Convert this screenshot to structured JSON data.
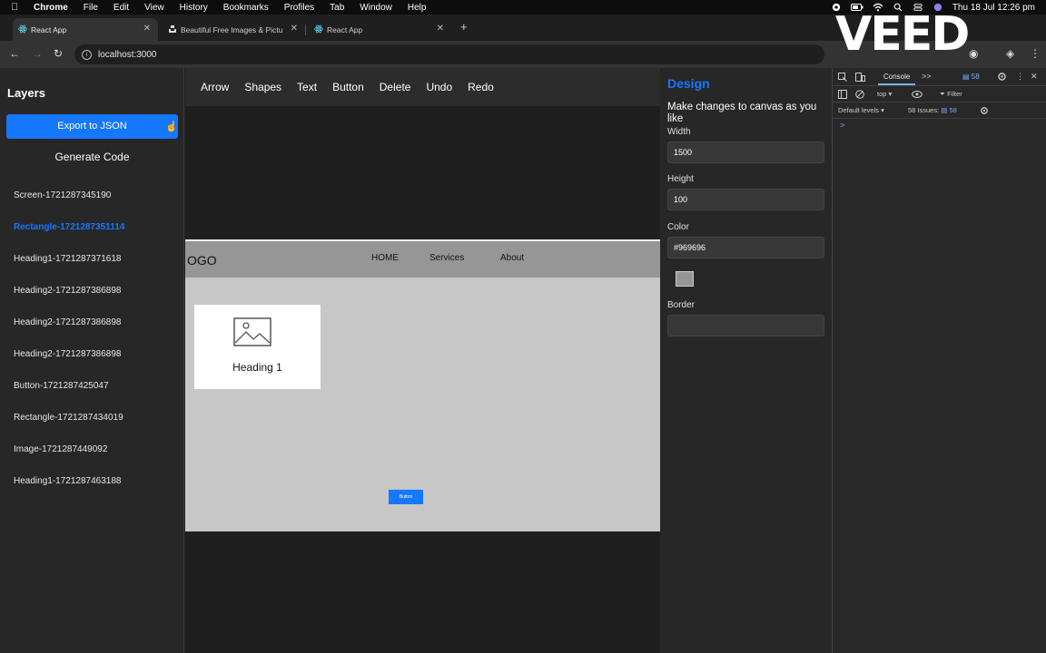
{
  "menubar": {
    "app": "Chrome",
    "items": [
      "File",
      "Edit",
      "View",
      "History",
      "Bookmarks",
      "Profiles",
      "Tab",
      "Window",
      "Help"
    ],
    "clock": "Thu 18 Jul  12:26 pm"
  },
  "tabs": [
    {
      "title": "React App"
    },
    {
      "title": "Beautiful Free Images & Pictu"
    },
    {
      "title": "React App"
    }
  ],
  "address": {
    "url": "localhost:3000"
  },
  "watermark": "VEED",
  "layers": {
    "title": "Layers",
    "export_label": "Export to JSON",
    "generate_label": "Generate Code",
    "items": [
      "Screen-1721287345190",
      "Rectangle-1721287351114",
      "Heading1-1721287371618",
      "Heading2-1721287386898",
      "Heading2-1721287386898",
      "Heading2-1721287386898",
      "Button-1721287425047",
      "Rectangle-1721287434019",
      "Image-1721287449092",
      "Heading1-1721287463188"
    ],
    "selected_index": 1
  },
  "toolbar": {
    "items": [
      "Arrow",
      "Shapes",
      "Text",
      "Button",
      "Delete",
      "Undo",
      "Redo"
    ]
  },
  "canvas": {
    "logo": "OGO",
    "nav": [
      "HOME",
      "Services",
      "About"
    ],
    "card_heading": "Heading 1",
    "button_label": "Button",
    "nav_color": "#969696"
  },
  "design": {
    "title": "Design",
    "description": "Make changes to canvas as you like",
    "width_label": "Width",
    "width_value": "1500",
    "height_label": "Height",
    "height_value": "100",
    "color_label": "Color",
    "color_value": "#969696",
    "border_label": "Border",
    "border_value": ""
  },
  "devtools": {
    "console_tab": "Console",
    "more": ">>",
    "issue_badge": "58",
    "context": "top",
    "filter_placeholder": "Filter",
    "levels": "Default levels",
    "issues_text": "58 Issues:",
    "issues_count": "58",
    "prompt": ">"
  },
  "colors": {
    "accent": "#1677ff",
    "panel": "#272727",
    "canvas_body": "#c7c7c7"
  }
}
